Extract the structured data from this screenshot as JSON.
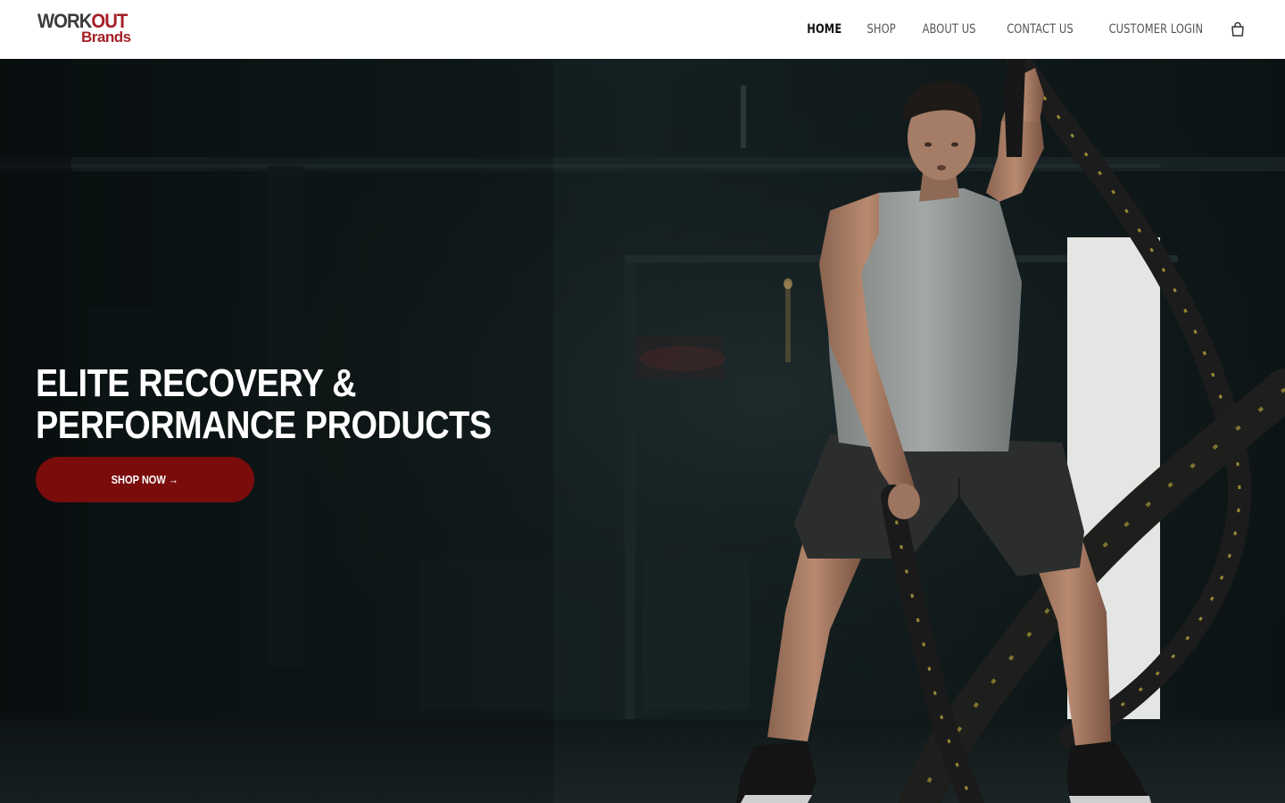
{
  "brand": {
    "logo_top_main": "WORK",
    "logo_top_accent": "OUT",
    "logo_bottom": "Brands"
  },
  "nav": {
    "items": [
      {
        "label": "HOME",
        "active": true
      },
      {
        "label": "SHOP",
        "active": false
      },
      {
        "label": "ABOUT US",
        "active": false
      },
      {
        "label": "CONTACT US",
        "active": false
      },
      {
        "label": "CUSTOMER LOGIN",
        "active": false
      }
    ],
    "cart_icon": "shopping-bag-icon"
  },
  "hero": {
    "title_line1": "ELITE RECOVERY &",
    "title_line2": "PERFORMANCE PRODUCTS",
    "cta_label": "SHOP NOW →"
  },
  "colors": {
    "brand_red": "#a41e24",
    "cta_red": "#7a0c0c",
    "logo_gray": "#3a3a3a",
    "nav_text": "#555555",
    "nav_active": "#111111",
    "hero_background": "#0f1617"
  }
}
